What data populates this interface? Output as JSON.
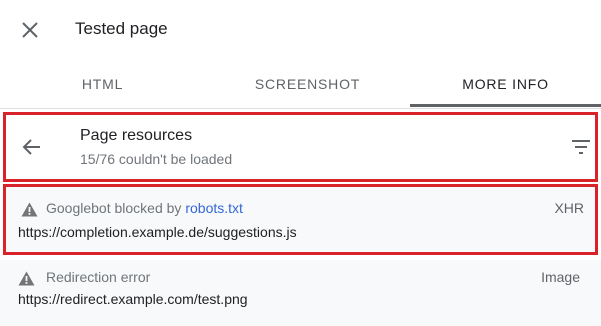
{
  "header": {
    "title": "Tested page",
    "close_icon": "close-icon"
  },
  "tabs": [
    {
      "label": "HTML",
      "active": false
    },
    {
      "label": "SCREENSHOT",
      "active": false
    },
    {
      "label": "MORE INFO",
      "active": true
    }
  ],
  "resources": {
    "title": "Page resources",
    "subtitle": "15/76 couldn't be loaded",
    "back_icon": "arrow-back-icon",
    "filter_icon": "filter-icon"
  },
  "items": [
    {
      "error_prefix": "Googlebot blocked by ",
      "error_link": "robots.txt",
      "type": "XHR",
      "url": "https://completion.example.de/suggestions.js",
      "icon": "warning-icon",
      "highlighted": true
    },
    {
      "error_prefix": "Redirection error",
      "error_link": "",
      "type": "Image",
      "url": "https://redirect.example.com/test.png",
      "icon": "warning-icon",
      "highlighted": false
    }
  ],
  "colors": {
    "highlight_border": "#d8232a",
    "link": "#3367d6",
    "row_background": "#f8f9fa"
  }
}
